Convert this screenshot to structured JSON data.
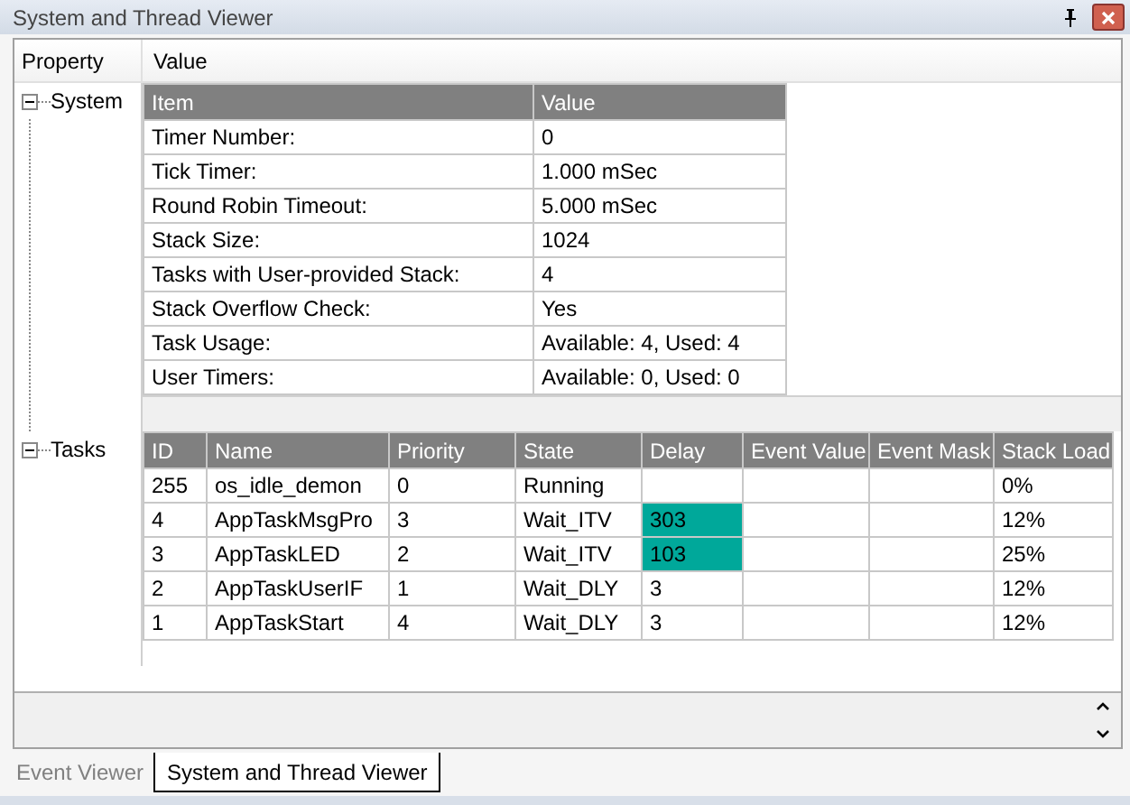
{
  "window": {
    "title": "System and Thread Viewer"
  },
  "columns": [
    "Property",
    "Value"
  ],
  "system": {
    "label": "System",
    "expanded": true,
    "headers": [
      "Item",
      "Value"
    ],
    "rows": [
      [
        "Timer Number:",
        "0"
      ],
      [
        "Tick Timer:",
        "1.000 mSec"
      ],
      [
        "Round Robin Timeout:",
        "5.000 mSec"
      ],
      [
        "Stack Size:",
        "1024"
      ],
      [
        "Tasks with User-provided Stack:",
        "4"
      ],
      [
        "Stack Overflow Check:",
        "Yes"
      ],
      [
        "Task Usage:",
        "Available: 4, Used: 4"
      ],
      [
        "User Timers:",
        "Available: 0, Used: 0"
      ]
    ]
  },
  "tasks": {
    "label": "Tasks",
    "expanded": true,
    "headers": [
      "ID",
      "Name",
      "Priority",
      "State",
      "Delay",
      "Event Value",
      "Event Mask",
      "Stack Load"
    ],
    "rows": [
      {
        "cells": [
          "255",
          "os_idle_demon",
          "0",
          "Running",
          "",
          "",
          "",
          "0%"
        ],
        "delay_highlighted": false
      },
      {
        "cells": [
          "4",
          "AppTaskMsgPro",
          "3",
          "Wait_ITV",
          "303",
          "",
          "",
          "12%"
        ],
        "delay_highlighted": true
      },
      {
        "cells": [
          "3",
          "AppTaskLED",
          "2",
          "Wait_ITV",
          "103",
          "",
          "",
          "25%"
        ],
        "delay_highlighted": true
      },
      {
        "cells": [
          "2",
          "AppTaskUserIF",
          "1",
          "Wait_DLY",
          "3",
          "",
          "",
          "12%"
        ],
        "delay_highlighted": false
      },
      {
        "cells": [
          "1",
          "AppTaskStart",
          "4",
          "Wait_DLY",
          "3",
          "",
          "",
          "12%"
        ],
        "delay_highlighted": false
      }
    ]
  },
  "tabs": [
    {
      "label": "Event Viewer",
      "selected": false
    },
    {
      "label": "System and Thread Viewer",
      "selected": true
    }
  ]
}
